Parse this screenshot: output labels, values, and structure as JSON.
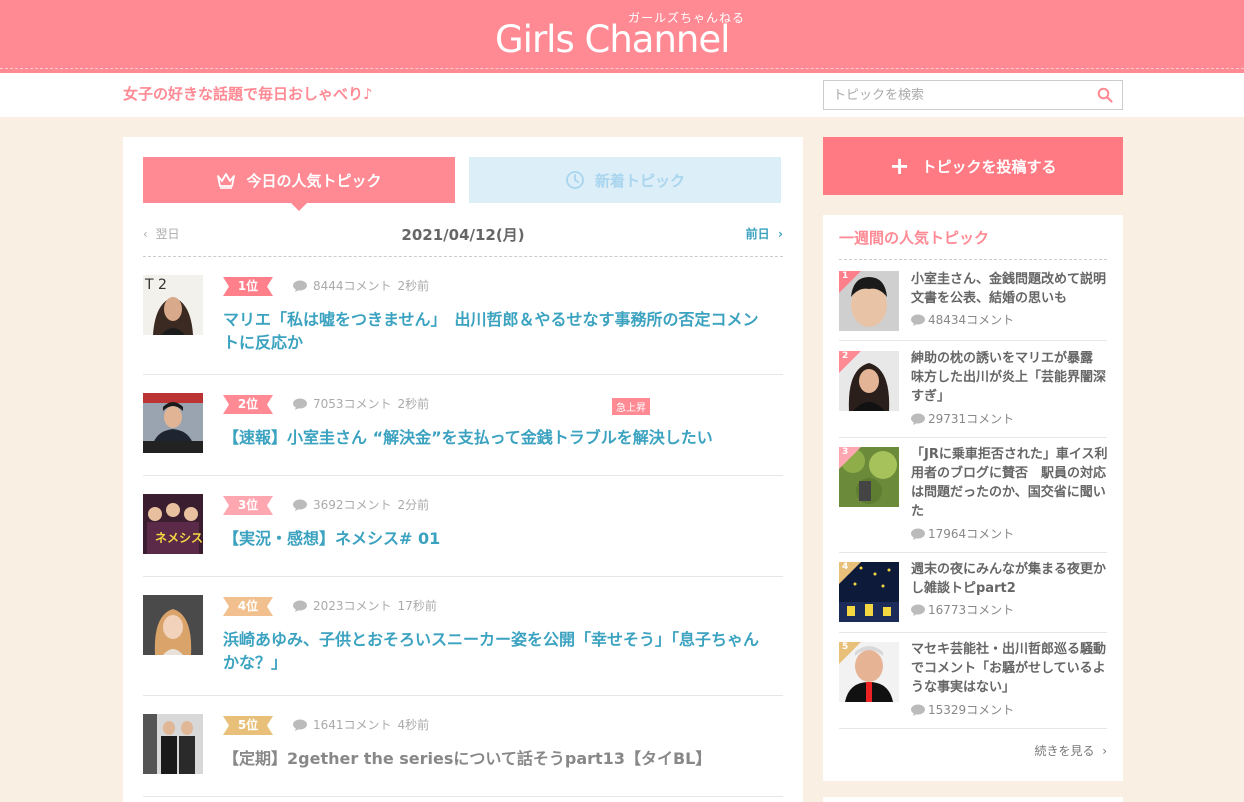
{
  "header": {
    "logo_text": "Girls Channel",
    "logo_kana": "ガールズちゃんねる",
    "tagline": "女子の好きな話題で毎日おしゃべり♪",
    "search_placeholder": "トピックを検索"
  },
  "tabs": {
    "popular_label": "今日の人気トピック",
    "new_label": "新着トピック"
  },
  "datebar": {
    "prev_label": "翌日",
    "current_date": "2021/04/12(月)",
    "next_label": "前日"
  },
  "topics": [
    {
      "rank": "1位",
      "comments": "8444コメント",
      "ago": "2秒前",
      "badge": "",
      "title": "マリエ「私は嘘をつきません」　出川哲郎＆やるせなす事務所の否定コメントに反応か",
      "rank_color": "#ff7f8b"
    },
    {
      "rank": "2位",
      "comments": "7053コメント",
      "ago": "2秒前",
      "badge": "急上昇",
      "title": "【速報】小室圭さん “解決金”を支払って金銭トラブルを解決したい",
      "rank_color": "#ff8a94"
    },
    {
      "rank": "3位",
      "comments": "3692コメント",
      "ago": "2分前",
      "badge": "",
      "title": "【実況・感想】ネメシス# 01",
      "rank_color": "#ffa7b0"
    },
    {
      "rank": "4位",
      "comments": "2023コメント",
      "ago": "17秒前",
      "badge": "",
      "title": "浜崎あゆみ、子供とおそろいスニーカー姿を公開「幸せそう」「息子ちゃんかな？」",
      "rank_color": "#f2c08e"
    },
    {
      "rank": "5位",
      "comments": "1641コメント",
      "ago": "4秒前",
      "badge": "",
      "title": "【定期】2gether the seriesについて話そうpart13【タイBL】",
      "rank_color": "#e8c07a"
    }
  ],
  "sidebar": {
    "post_button_label": "トピックを投稿する",
    "weekly_title": "一週間の人気トピック",
    "items": [
      {
        "rank": "1",
        "title": "小室圭さん、金銭問題改めて説明文書を公表、結婚の思いも",
        "comments": "48434コメント",
        "rank_color": "#ff7f8b"
      },
      {
        "rank": "2",
        "title": "紳助の枕の誘いをマリエが暴露　味方した出川が炎上「芸能界闇深すぎ」",
        "comments": "29731コメント",
        "rank_color": "#ff8a94"
      },
      {
        "rank": "3",
        "title": "「JRに乗車拒否された」車イス利用者のブログに賛否　駅員の対応は問題だったのか、国交省に聞いた",
        "comments": "17964コメント",
        "rank_color": "#ffa7b0"
      },
      {
        "rank": "4",
        "title": "週末の夜にみんなが集まる夜更かし雑談トピpart2",
        "comments": "16773コメント",
        "rank_color": "#e8c07a"
      },
      {
        "rank": "5",
        "title": "マセキ芸能社・出川哲郎巡る騒動でコメント「お騒がせしているような事実はない」",
        "comments": "15329コメント",
        "rank_color": "#e8c07a"
      }
    ],
    "more_label": "続きを見る"
  },
  "colors": {
    "brand_pink": "#ff8a94",
    "link_blue": "#3ba2c0",
    "page_bg": "#f9efe3"
  }
}
